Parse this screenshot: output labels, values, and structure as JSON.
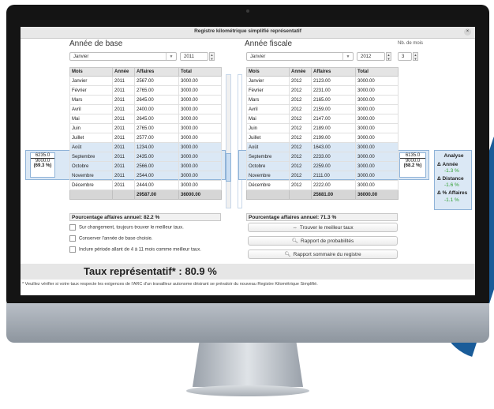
{
  "window_title": "Registre kilométrique simplifié représentatif",
  "close_label": "×",
  "left": {
    "section_title": "Année de base",
    "month_value": "Janvier",
    "year_value": "2011",
    "headers": [
      "Mois",
      "Année",
      "Affaires",
      "Total"
    ],
    "rows": [
      [
        "Janvier",
        "2011",
        "2567.00",
        "3000.00"
      ],
      [
        "Février",
        "2011",
        "2765.00",
        "3000.00"
      ],
      [
        "Mars",
        "2011",
        "2645.00",
        "3000.00"
      ],
      [
        "Avril",
        "2011",
        "2400.00",
        "3000.00"
      ],
      [
        "Mai",
        "2011",
        "2645.00",
        "3000.00"
      ],
      [
        "Juin",
        "2011",
        "2765.00",
        "3000.00"
      ],
      [
        "Juillet",
        "2011",
        "2577.00",
        "3000.00"
      ],
      [
        "Août",
        "2011",
        "1234.00",
        "3000.00"
      ],
      [
        "Septembre",
        "2011",
        "2435.00",
        "3000.00"
      ],
      [
        "Octobre",
        "2011",
        "2566.00",
        "3000.00"
      ],
      [
        "Novembre",
        "2011",
        "2544.00",
        "3000.00"
      ],
      [
        "Décembre",
        "2011",
        "2444.00",
        "3000.00"
      ]
    ],
    "totals": [
      "",
      "",
      "29587.00",
      "36000.00"
    ],
    "percentage": "Pourcentage affaires annuel:  82.2 %",
    "callout": [
      "6235.0",
      "9000.0",
      "(69.3 %)"
    ]
  },
  "right": {
    "section_title": "Année fiscale",
    "months_label": "Nb. de mois",
    "month_value": "Janvier",
    "year_value": "2012",
    "months_value": "3",
    "headers": [
      "Mois",
      "Année",
      "Affaires",
      "Total"
    ],
    "rows": [
      [
        "Janvier",
        "2012",
        "2123.00",
        "3000.00"
      ],
      [
        "Février",
        "2012",
        "2231.00",
        "3000.00"
      ],
      [
        "Mars",
        "2012",
        "2165.00",
        "3000.00"
      ],
      [
        "Avril",
        "2012",
        "2159.00",
        "3000.00"
      ],
      [
        "Mai",
        "2012",
        "2147.00",
        "3000.00"
      ],
      [
        "Juin",
        "2012",
        "2189.00",
        "3000.00"
      ],
      [
        "Juillet",
        "2012",
        "2199.00",
        "3000.00"
      ],
      [
        "Août",
        "2012",
        "1643.00",
        "3000.00"
      ],
      [
        "Septembre",
        "2012",
        "2233.00",
        "3000.00"
      ],
      [
        "Octobre",
        "2012",
        "2259.00",
        "3000.00"
      ],
      [
        "Novembre",
        "2012",
        "2111.00",
        "3000.00"
      ],
      [
        "Décembre",
        "2012",
        "2222.00",
        "3000.00"
      ]
    ],
    "totals": [
      "",
      "",
      "25681.00",
      "36000.00"
    ],
    "percentage": "Pourcentage affaires annuel:  71.3 %",
    "callout": [
      "6135.0",
      "9000.0",
      "(68.2 %)"
    ]
  },
  "analyse": {
    "title": "Analyse",
    "annee_label": "Δ Année",
    "annee_value": "-1.3 %",
    "distance_label": "Δ Distance",
    "distance_value": "-1.6 %",
    "affaires_label": "Δ % Affaires",
    "affaires_value": "-1.1 %"
  },
  "options": [
    "Sur changement, toujours trouver le meilleur taux.",
    "Conserver l'année de base choisie.",
    "Inclure période allant de 4 à 11 mois comme meilleur taux."
  ],
  "buttons": {
    "best_rate": "Trouver le meilleur taux",
    "probabilities": "Rapport de probabilités",
    "summary": "Rapport sommaire du registre"
  },
  "result": "Taux représentatif* : 80.9 %",
  "footnote": "* Veuillez vérifier si votre taux respecte les exigences de l'ARC d'un travailleur autonome désirant se prévaloir du nouveau Registre Kilométrique Simplifié.",
  "colors": {
    "accent": "#1a5c99",
    "highlight": "#dbe8f5",
    "positive": "#2e9e2e"
  }
}
